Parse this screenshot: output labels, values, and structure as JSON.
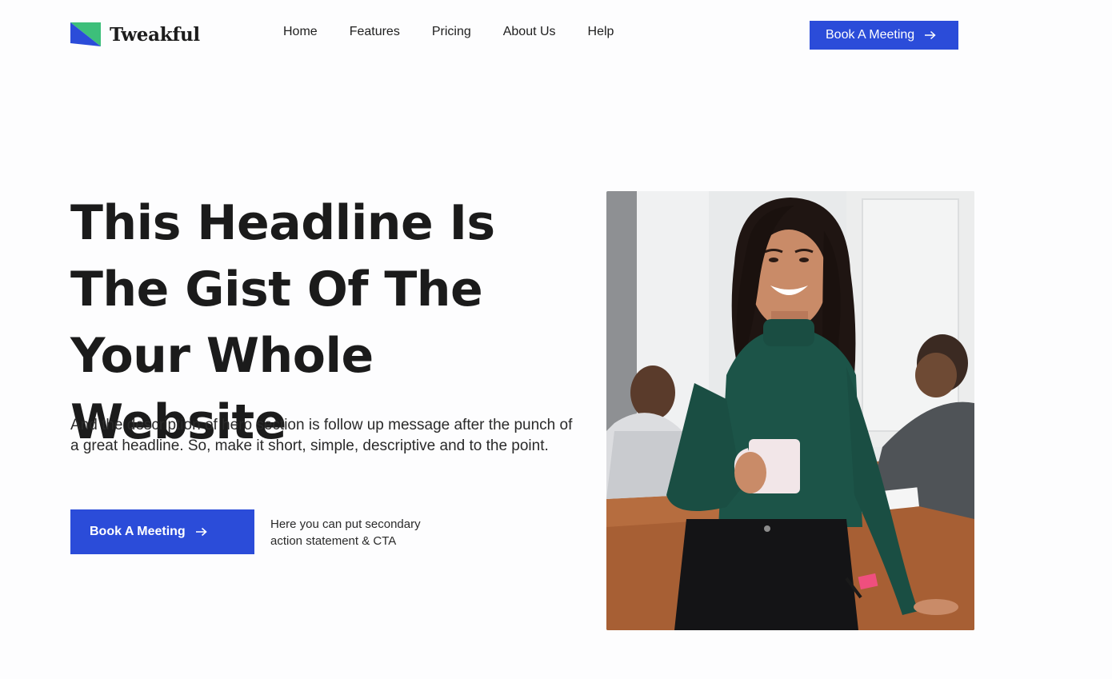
{
  "brand": {
    "name": "Tweakful",
    "logo_icon": "triangle-flag-logo-icon",
    "colors": {
      "blue": "#2b4cd9",
      "green": "#3dbf7a",
      "accent": "#2b4cd9"
    }
  },
  "nav": {
    "items": [
      {
        "label": "Home"
      },
      {
        "label": "Features"
      },
      {
        "label": "Pricing"
      },
      {
        "label": "About Us"
      },
      {
        "label": "Help"
      }
    ]
  },
  "header_cta": {
    "label": "Book A Meeting",
    "icon": "arrow-right-icon"
  },
  "hero": {
    "headline": "This Headline Is The Gist Of The Your Whole Website",
    "description": "And the description of hero section is follow up message after the punch of a great headline. So, make it short, simple, descriptive and to the point.",
    "cta_label": "Book A Meeting",
    "cta_icon": "arrow-right-icon",
    "secondary_text": "Here you can put secondary action statement & CTA"
  },
  "image": {
    "subject": "smiling-woman-holding-mug-photo"
  }
}
